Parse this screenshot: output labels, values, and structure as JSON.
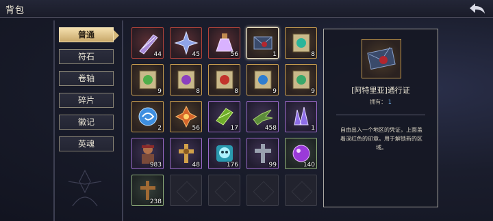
{
  "header": {
    "title": "背包"
  },
  "tabs": [
    {
      "label": "普通",
      "active": true
    },
    {
      "label": "符石",
      "active": false
    },
    {
      "label": "卷轴",
      "active": false
    },
    {
      "label": "碎片",
      "active": false
    },
    {
      "label": "徽记",
      "active": false
    },
    {
      "label": "英魂",
      "active": false
    }
  ],
  "items": [
    {
      "icon": "purple-crystal-shard-icon",
      "count": "44",
      "rarity": "red"
    },
    {
      "icon": "star-crystal-icon",
      "count": "45",
      "rarity": "red"
    },
    {
      "icon": "potion-flask-icon",
      "count": "56",
      "rarity": "red"
    },
    {
      "icon": "sealed-letter-icon",
      "count": "1",
      "rarity": "gold",
      "selected": true
    },
    {
      "icon": "cyan-rune-scroll-icon",
      "count": "8",
      "rarity": "gold"
    },
    {
      "icon": "green-rune-scroll-icon",
      "count": "9",
      "rarity": "gold"
    },
    {
      "icon": "purple-rune-scroll-icon",
      "count": "8",
      "rarity": "gold"
    },
    {
      "icon": "red-rune-scroll-icon",
      "count": "8",
      "rarity": "gold"
    },
    {
      "icon": "blue-rune-scroll-icon",
      "count": "9",
      "rarity": "gold"
    },
    {
      "icon": "green-sigil-scroll-icon",
      "count": "9",
      "rarity": "gold"
    },
    {
      "icon": "blue-swirl-orb-icon",
      "count": "2",
      "rarity": "gold"
    },
    {
      "icon": "orange-cross-talisman-icon",
      "count": "56",
      "rarity": "gold"
    },
    {
      "icon": "green-wrapped-gem-icon",
      "count": "17",
      "rarity": "purple"
    },
    {
      "icon": "green-bird-icon",
      "count": "458",
      "rarity": "purple"
    },
    {
      "icon": "purple-crystal-cluster-icon",
      "count": "1",
      "rarity": "purple"
    },
    {
      "icon": "warrior-portrait-icon",
      "count": "983",
      "rarity": "purple"
    },
    {
      "icon": "golden-cross-icon",
      "count": "48",
      "rarity": "purple"
    },
    {
      "icon": "cyan-skull-icon",
      "count": "176",
      "rarity": "purple"
    },
    {
      "icon": "stone-cross-icon",
      "count": "99",
      "rarity": "purple"
    },
    {
      "icon": "purple-orb-icon",
      "count": "140",
      "rarity": "green"
    },
    {
      "icon": "wooden-cross-icon",
      "count": "238",
      "rarity": "green"
    },
    {
      "icon": "",
      "count": "",
      "rarity": "empty"
    },
    {
      "icon": "",
      "count": "",
      "rarity": "empty"
    },
    {
      "icon": "",
      "count": "",
      "rarity": "empty"
    },
    {
      "icon": "",
      "count": "",
      "rarity": "empty"
    }
  ],
  "detail": {
    "icon": "sealed-letter-icon",
    "name": "[阿特里亚]通行证",
    "owned_label": "拥有：",
    "owned_value": "1",
    "description": "自由出入一个地区的凭证，上面盖着深红色的印章。用于解锁新的区域。"
  }
}
